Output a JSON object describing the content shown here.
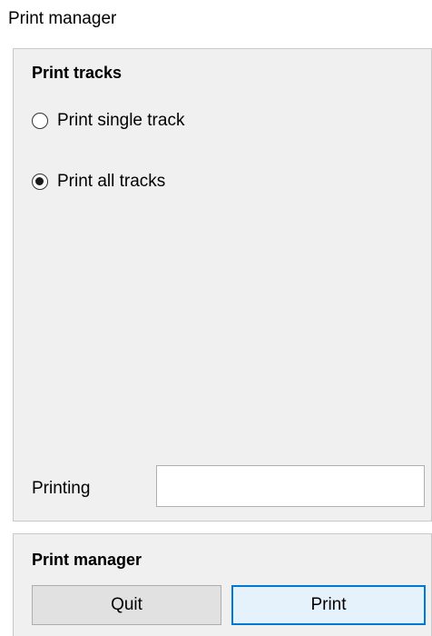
{
  "window": {
    "title": "Print manager"
  },
  "print_tracks": {
    "heading": "Print tracks",
    "options": [
      {
        "label": "Print single track",
        "checked": false
      },
      {
        "label": "Print all tracks",
        "checked": true
      }
    ],
    "printing_label": "Printing",
    "printing_value": ""
  },
  "print_manager": {
    "heading": "Print manager",
    "quit_label": "Quit",
    "print_label": "Print"
  },
  "colors": {
    "panel_bg": "#f0f0f0",
    "button_bg": "#e1e1e1",
    "focus_border": "#0078d7"
  }
}
